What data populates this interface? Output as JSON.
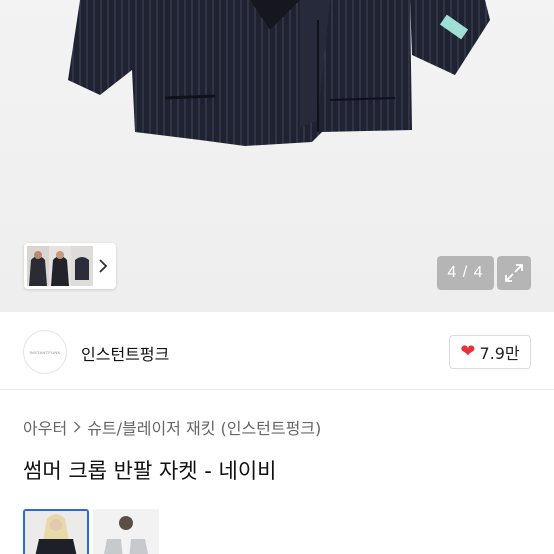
{
  "gallery": {
    "counter": "4 / 4",
    "icons": {
      "next": "chevron-right-icon",
      "expand": "expand-icon"
    }
  },
  "shop": {
    "name": "인스턴트펑크",
    "logo_text": "INSTANTFUNK",
    "like_count": "7.9만",
    "like_color": "#e8323c"
  },
  "breadcrumb": {
    "items": [
      "아우터",
      "슈트/블레이저 재킷 (인스턴트펑크)"
    ]
  },
  "product": {
    "title": "썸머 크롭 반팔 자켓 - 네이비"
  },
  "colors": {
    "selected_border": "#2a6bd6"
  }
}
